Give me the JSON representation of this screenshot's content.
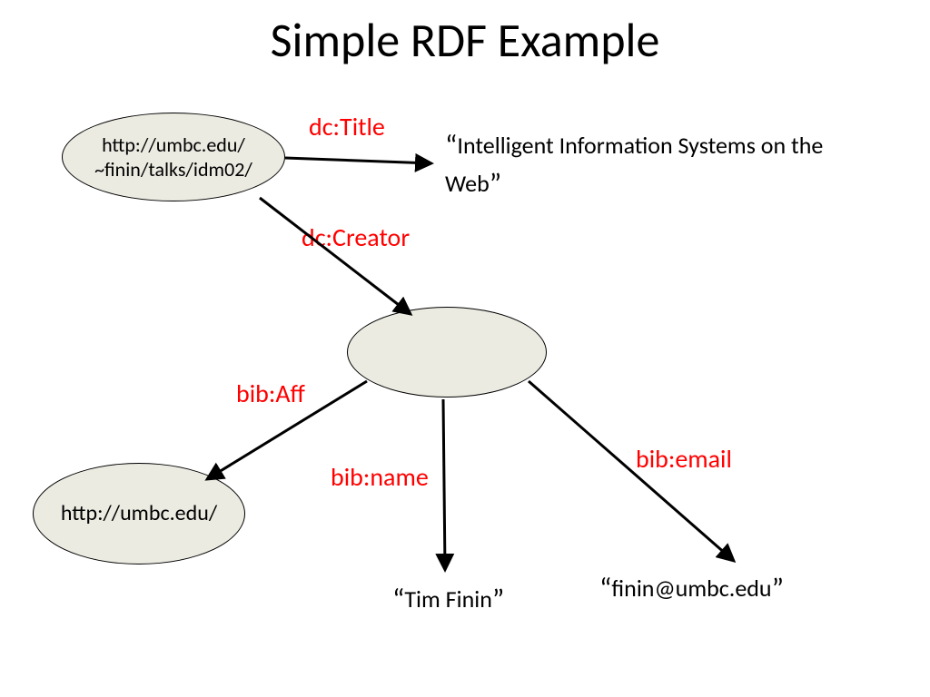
{
  "title": "Simple RDF Example",
  "nodes": {
    "subject_uri_line1": "http://umbc.edu/",
    "subject_uri_line2": "~finin/talks/idm02/",
    "aff_uri": "http://umbc.edu/"
  },
  "literals": {
    "title_value": "Intelligent Information Systems on the Web",
    "name_value": "Tim Finin",
    "email_value": "finin@umbc.edu"
  },
  "edges": {
    "dc_title": "dc:Title",
    "dc_creator": "dc:Creator",
    "bib_aff": "bib:Aff",
    "bib_name": "bib:name",
    "bib_email": "bib:email"
  }
}
